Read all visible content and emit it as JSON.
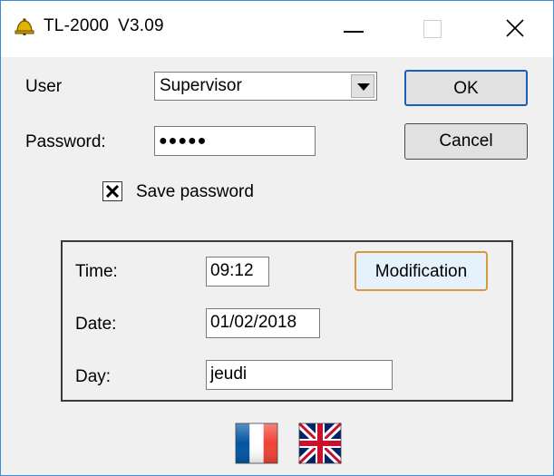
{
  "window": {
    "title": "TL-2000",
    "version": "V3.09",
    "colors": {
      "border": "#3c8cd6",
      "client_bg": "#f0f0f0",
      "ok_border": "#1a5fb4",
      "modification_border": "#d69a3a"
    }
  },
  "titlebar_icons": {
    "app": "bell-icon",
    "minimize": "minimize-icon",
    "maximize": "maximize-icon",
    "close": "close-icon"
  },
  "login": {
    "user_label": "User",
    "user_value": "Supervisor",
    "password_label": "Password:",
    "password_value": "●●●●●",
    "save_password_label": "Save password",
    "save_password_checked": true
  },
  "buttons": {
    "ok": "OK",
    "cancel": "Cancel",
    "modification": "Modification"
  },
  "datetime": {
    "time_label": "Time:",
    "time_value": "09:12",
    "date_label": "Date:",
    "date_value": "01/02/2018",
    "day_label": "Day:",
    "day_value": "jeudi"
  },
  "languages": [
    {
      "icon": "french-flag-icon",
      "colors": [
        "#0055a4",
        "#ffffff",
        "#ef4135"
      ]
    },
    {
      "icon": "uk-flag-icon",
      "colors": [
        "#012169",
        "#ffffff",
        "#c8102e"
      ]
    }
  ]
}
